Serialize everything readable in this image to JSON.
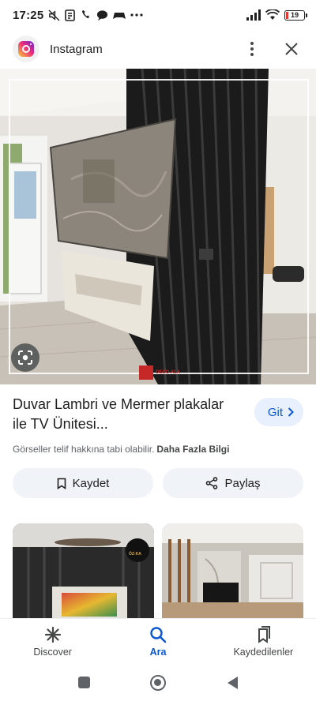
{
  "status_bar": {
    "time": "17:25",
    "battery": "19",
    "icons": [
      "mute-icon",
      "notification-icon",
      "call-icon",
      "chat-icon",
      "game-icon",
      "more-dots-icon",
      "signal-icon",
      "wifi-icon",
      "battery-icon"
    ]
  },
  "header": {
    "app_name": "Instagram",
    "icon": "instagram-logo-icon",
    "menu_icon": "more-vert-icon",
    "close_icon": "close-icon"
  },
  "hero": {
    "watermark": "DECO ALA",
    "lens_icon": "google-lens-icon"
  },
  "result": {
    "title": "Duvar Lambri ve Mermer plakalar ile TV Ünitesi...",
    "visit_label": "Git",
    "copyright_text": "Görseller telif hakkına tabi olabilir.",
    "more_info": "Daha Fazla Bilgi"
  },
  "actions": {
    "save_label": "Kaydet",
    "share_label": "Paylaş"
  },
  "related": [
    {
      "badge": "ÖZ-KA"
    },
    {
      "badge": ""
    }
  ],
  "bottom_nav": [
    {
      "label": "Discover",
      "icon": "asterisk-icon",
      "active": false
    },
    {
      "label": "Ara",
      "icon": "search-icon",
      "active": true
    },
    {
      "label": "Kaydedilenler",
      "icon": "bookmarks-icon",
      "active": false
    }
  ],
  "colors": {
    "accent": "#0b57d0",
    "accent_bg": "#e8f0fe",
    "pill_bg": "#f0f3f7",
    "text": "#1f1f1f",
    "muted": "#5f6368"
  }
}
